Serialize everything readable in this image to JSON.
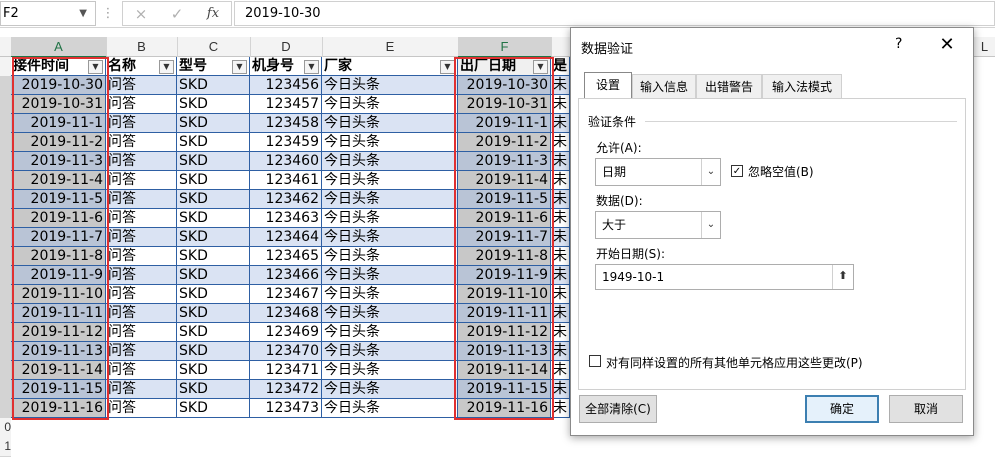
{
  "formula_bar": {
    "name_box": "F2",
    "formula": "2019-10-30",
    "fx_label": "fx",
    "cancel_glyph": "×",
    "enter_glyph": "✓"
  },
  "columns": [
    "A",
    "B",
    "C",
    "D",
    "E",
    "F",
    ""
  ],
  "right_column": "L",
  "headers": [
    "接件时间",
    "名称",
    "型号",
    "机身号",
    "厂家",
    "出厂日期",
    "是"
  ],
  "row_numbers": [
    "",
    "",
    "",
    "",
    "",
    "",
    "",
    "",
    "",
    "",
    "",
    "",
    "",
    "",
    "",
    "",
    "",
    "",
    "",
    "0",
    "1"
  ],
  "rows": [
    {
      "date1": "2019-10-30",
      "name": "问答",
      "model": "SKD",
      "serial": "123456",
      "maker": "今日头条",
      "date2": "2019-10-30",
      "last": "未"
    },
    {
      "date1": "2019-10-31",
      "name": "问答",
      "model": "SKD",
      "serial": "123457",
      "maker": "今日头条",
      "date2": "2019-10-31",
      "last": "未"
    },
    {
      "date1": "2019-11-1",
      "name": "问答",
      "model": "SKD",
      "serial": "123458",
      "maker": "今日头条",
      "date2": "2019-11-1",
      "last": "未"
    },
    {
      "date1": "2019-11-2",
      "name": "问答",
      "model": "SKD",
      "serial": "123459",
      "maker": "今日头条",
      "date2": "2019-11-2",
      "last": "未"
    },
    {
      "date1": "2019-11-3",
      "name": "问答",
      "model": "SKD",
      "serial": "123460",
      "maker": "今日头条",
      "date2": "2019-11-3",
      "last": "未"
    },
    {
      "date1": "2019-11-4",
      "name": "问答",
      "model": "SKD",
      "serial": "123461",
      "maker": "今日头条",
      "date2": "2019-11-4",
      "last": "未"
    },
    {
      "date1": "2019-11-5",
      "name": "问答",
      "model": "SKD",
      "serial": "123462",
      "maker": "今日头条",
      "date2": "2019-11-5",
      "last": "未"
    },
    {
      "date1": "2019-11-6",
      "name": "问答",
      "model": "SKD",
      "serial": "123463",
      "maker": "今日头条",
      "date2": "2019-11-6",
      "last": "未"
    },
    {
      "date1": "2019-11-7",
      "name": "问答",
      "model": "SKD",
      "serial": "123464",
      "maker": "今日头条",
      "date2": "2019-11-7",
      "last": "未"
    },
    {
      "date1": "2019-11-8",
      "name": "问答",
      "model": "SKD",
      "serial": "123465",
      "maker": "今日头条",
      "date2": "2019-11-8",
      "last": "未"
    },
    {
      "date1": "2019-11-9",
      "name": "问答",
      "model": "SKD",
      "serial": "123466",
      "maker": "今日头条",
      "date2": "2019-11-9",
      "last": "未"
    },
    {
      "date1": "2019-11-10",
      "name": "问答",
      "model": "SKD",
      "serial": "123467",
      "maker": "今日头条",
      "date2": "2019-11-10",
      "last": "未"
    },
    {
      "date1": "2019-11-11",
      "name": "问答",
      "model": "SKD",
      "serial": "123468",
      "maker": "今日头条",
      "date2": "2019-11-11",
      "last": "未"
    },
    {
      "date1": "2019-11-12",
      "name": "问答",
      "model": "SKD",
      "serial": "123469",
      "maker": "今日头条",
      "date2": "2019-11-12",
      "last": "未"
    },
    {
      "date1": "2019-11-13",
      "name": "问答",
      "model": "SKD",
      "serial": "123470",
      "maker": "今日头条",
      "date2": "2019-11-13",
      "last": "未"
    },
    {
      "date1": "2019-11-14",
      "name": "问答",
      "model": "SKD",
      "serial": "123471",
      "maker": "今日头条",
      "date2": "2019-11-14",
      "last": "未"
    },
    {
      "date1": "2019-11-15",
      "name": "问答",
      "model": "SKD",
      "serial": "123472",
      "maker": "今日头条",
      "date2": "2019-11-15",
      "last": "未"
    },
    {
      "date1": "2019-11-16",
      "name": "问答",
      "model": "SKD",
      "serial": "123473",
      "maker": "今日头条",
      "date2": "2019-11-16",
      "last": "未"
    }
  ],
  "colors": {
    "band_blue": "#dae3f3",
    "selected_grey": "#c8c8c8",
    "highlight_red": "#e03030",
    "border_blue": "#2e5fa3",
    "excel_green": "#217346"
  },
  "dialog": {
    "title": "数据验证",
    "help": "?",
    "close": "✕",
    "tabs": [
      "设置",
      "输入信息",
      "出错警告",
      "输入法模式"
    ],
    "section": "验证条件",
    "allow_label": "允许(A):",
    "allow_value": "日期",
    "ignore_blank_label": "忽略空值(B)",
    "ignore_blank_checked": true,
    "data_label": "数据(D):",
    "data_value": "大于",
    "start_label": "开始日期(S):",
    "start_value": "1949-10-1",
    "apply_all_label": "对有同样设置的所有其他单元格应用这些更改(P)",
    "apply_all_checked": false,
    "clear_all": "全部清除(C)",
    "ok": "确定",
    "cancel": "取消"
  }
}
